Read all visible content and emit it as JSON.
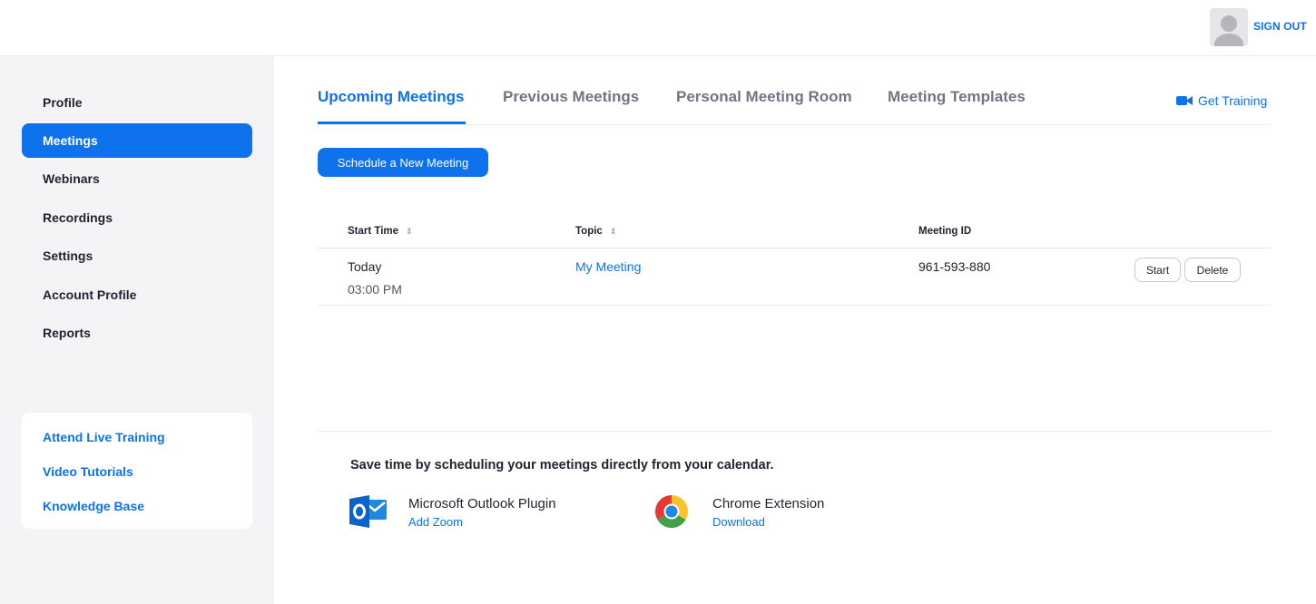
{
  "header": {
    "sign_out": "SIGN OUT"
  },
  "sidebar": {
    "items": [
      {
        "label": "Profile",
        "active": false
      },
      {
        "label": "Meetings",
        "active": true
      },
      {
        "label": "Webinars",
        "active": false
      },
      {
        "label": "Recordings",
        "active": false
      },
      {
        "label": "Settings",
        "active": false
      },
      {
        "label": "Account Profile",
        "active": false
      },
      {
        "label": "Reports",
        "active": false
      }
    ],
    "help_links": [
      {
        "label": "Attend Live Training"
      },
      {
        "label": "Video Tutorials"
      },
      {
        "label": "Knowledge Base"
      }
    ]
  },
  "tabs": [
    {
      "label": "Upcoming Meetings",
      "active": true
    },
    {
      "label": "Previous Meetings",
      "active": false
    },
    {
      "label": "Personal Meeting Room",
      "active": false
    },
    {
      "label": "Meeting Templates",
      "active": false
    }
  ],
  "get_training": {
    "label": "Get Training",
    "icon": "video-camera-icon"
  },
  "schedule_button": "Schedule a New Meeting",
  "table": {
    "columns": [
      "Start Time",
      "Topic",
      "Meeting ID"
    ],
    "sort_icon": "⇕",
    "rows": [
      {
        "day": "Today",
        "time": "03:00 PM",
        "topic": "My Meeting",
        "meeting_id": "961-593-880",
        "actions": [
          "Start",
          "Delete"
        ]
      }
    ]
  },
  "calendar_promo": {
    "title": "Save time by scheduling your meetings directly from your calendar.",
    "plugins": [
      {
        "name": "Microsoft Outlook Plugin",
        "link": "Add Zoom",
        "icon": "outlook-icon"
      },
      {
        "name": "Chrome Extension",
        "link": "Download",
        "icon": "chrome-icon"
      }
    ]
  },
  "colors": {
    "accent": "#0e72ed",
    "sidebar_bg": "#f4f4f6",
    "text": "#232333"
  }
}
